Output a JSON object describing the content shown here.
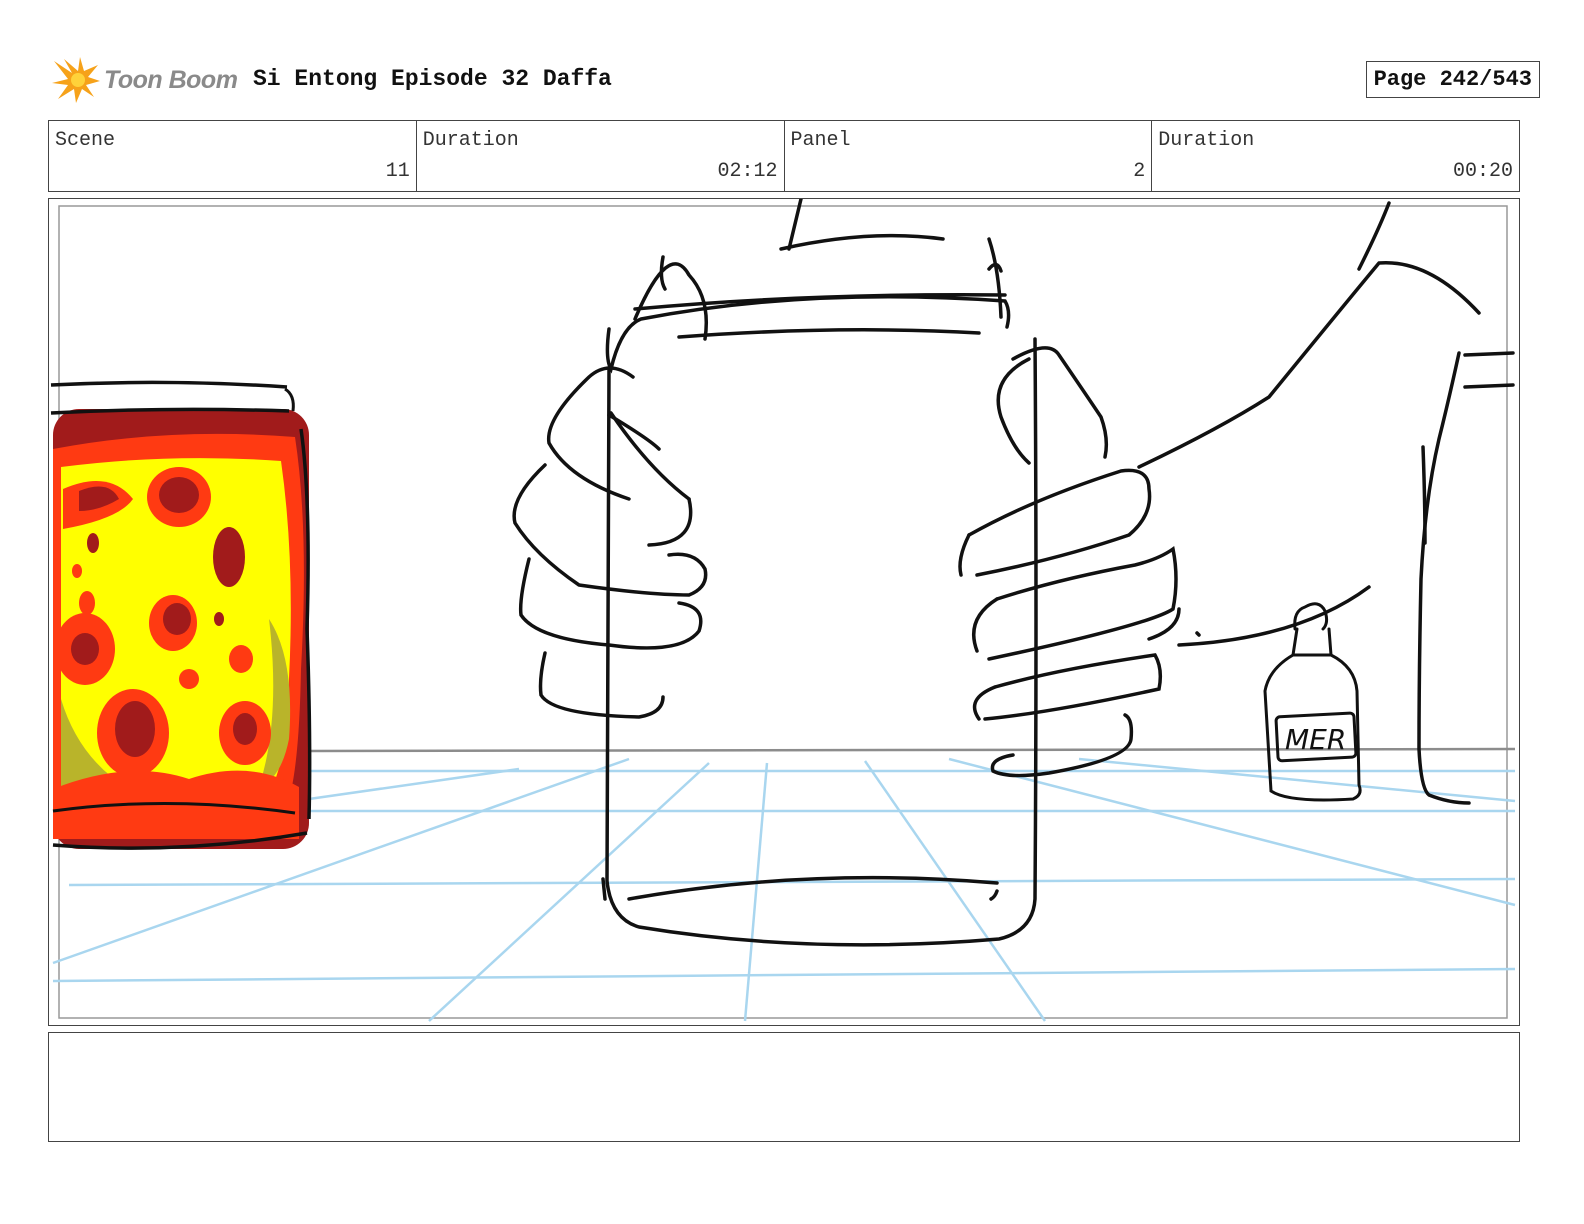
{
  "header": {
    "logo_text": "Toon Boom",
    "title": "Si Entong Episode 32 Daffa",
    "page": "Page 242/543"
  },
  "info": {
    "scene_label": "Scene",
    "scene_value": "11",
    "scene_duration_label": "Duration",
    "scene_duration_value": "02:12",
    "panel_label": "Panel",
    "panel_value": "2",
    "panel_duration_label": "Duration",
    "panel_duration_value": "00:20"
  },
  "drawing": {
    "bottle_label": "MER",
    "colors": {
      "ink": "#111111",
      "grid": "#a9d6ef",
      "sauce_dark": "#a11b1b",
      "sauce_red": "#ff3a12",
      "sauce_yellow": "#ffff00",
      "sauce_olive": "#b9b42a",
      "logo_orange": "#f6a21a"
    }
  },
  "notes": {
    "text": ""
  }
}
